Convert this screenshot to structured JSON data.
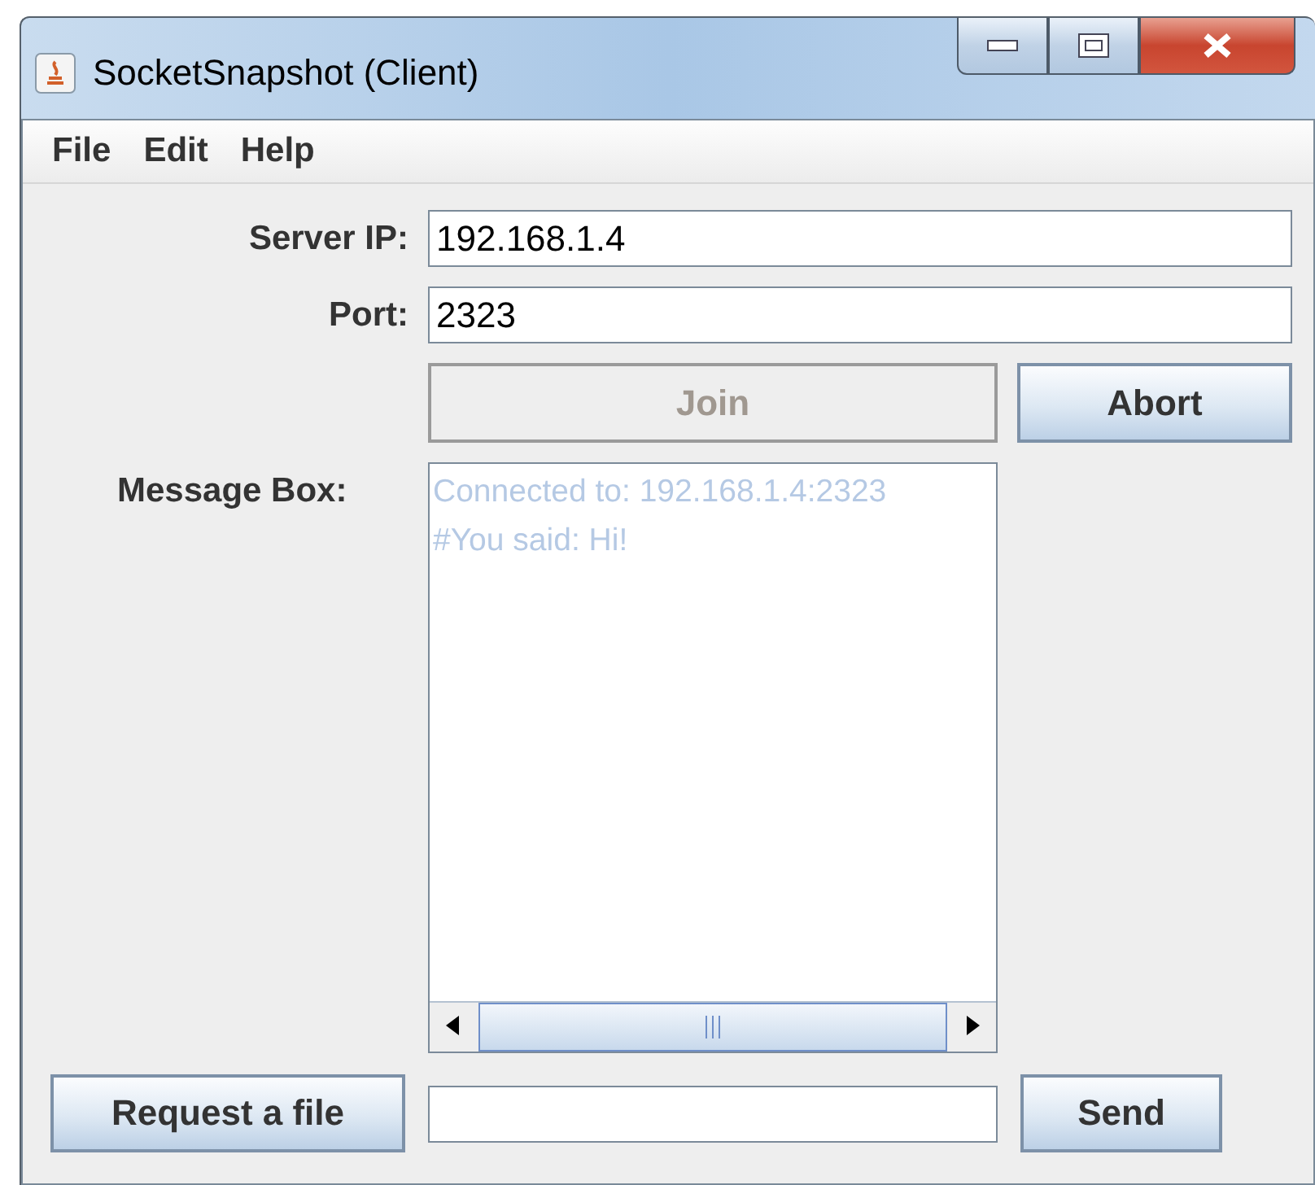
{
  "window": {
    "title": "SocketSnapshot (Client)"
  },
  "menu": [
    "File",
    "Edit",
    "Help"
  ],
  "fields": [
    {
      "label": "Server IP:",
      "value": "192.168.1.4"
    },
    {
      "label": "Port:",
      "value": "2323"
    }
  ],
  "buttons": [
    {
      "label": "Join",
      "disabled": true
    },
    {
      "label": "Abort",
      "disabled": false
    }
  ],
  "message_box": {
    "label": "Message Box:",
    "lines": [
      "Connected to: 192.168.1.4:2323",
      "#You said: Hi!"
    ]
  },
  "bottom": {
    "request_button": "Request a file",
    "send_button": "Send"
  }
}
